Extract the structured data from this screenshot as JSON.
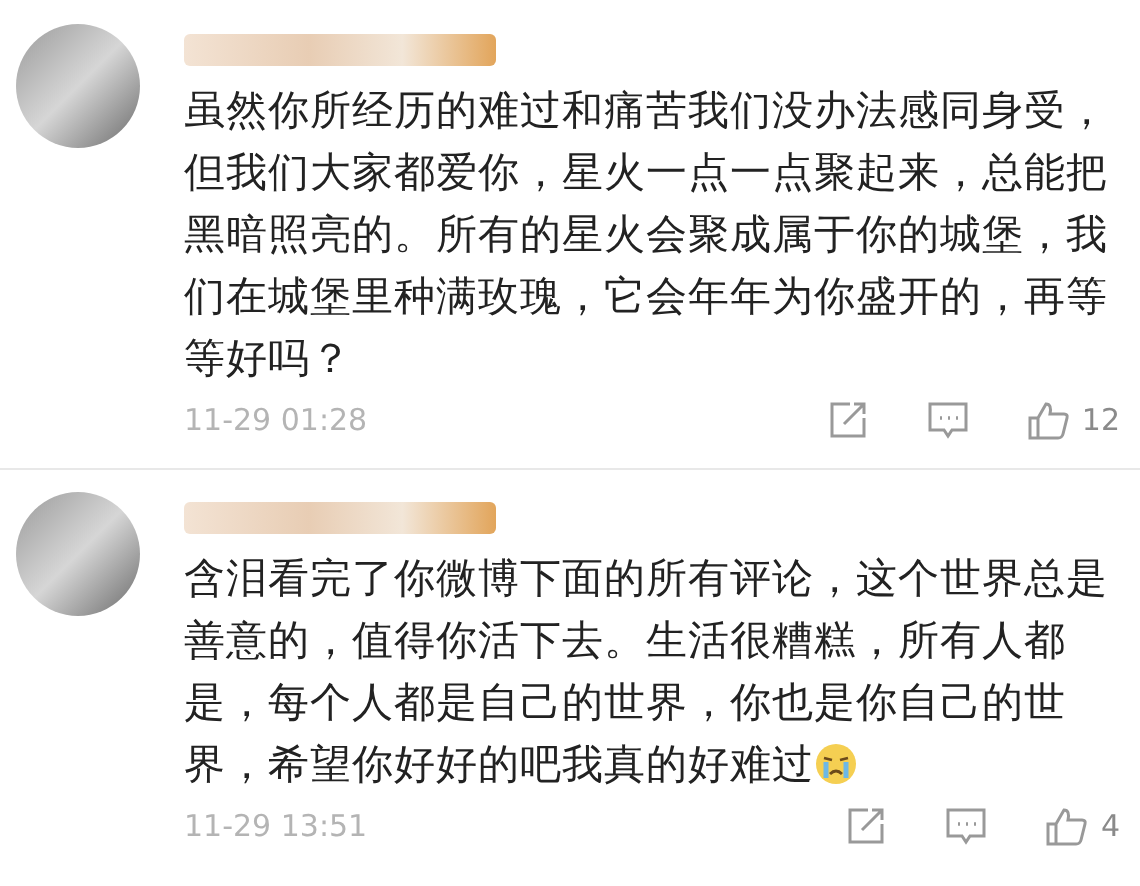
{
  "comments": [
    {
      "text": "虽然你所经历的难过和痛苦我们没办法感同身受，但我们大家都爱你，星火一点一点聚起来，总能把黑暗照亮的。所有的星火会聚成属于你的城堡，我们在城堡里种满玫瑰，它会年年为你盛开的，再等等好吗？",
      "emoji": false,
      "time": "11-29 01:28",
      "likes": "12"
    },
    {
      "text": "含泪看完了你微博下面的所有评论，这个世界总是善意的，值得你活下去。生活很糟糕，所有人都是，每个人都是自己的世界，你也是你自己的世界，希望你好好的吧我真的好难过",
      "emoji": true,
      "time": "11-29 13:51",
      "likes": "4"
    }
  ]
}
